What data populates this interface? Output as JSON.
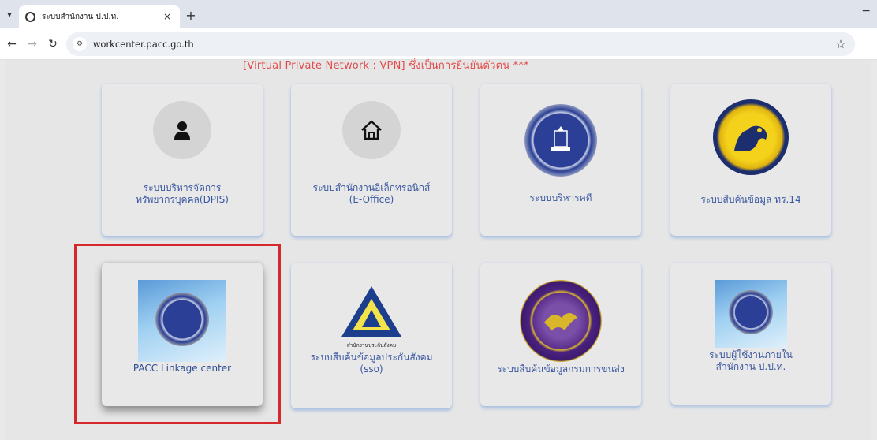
{
  "browser": {
    "tab_title": "ระบบสำนักงาน ป.ป.ท.",
    "tab_close": "×",
    "new_tab": "+",
    "minimize": "−",
    "url": "workcenter.pacc.go.th",
    "icons": [
      "dropdown-icon",
      "globe-icon",
      "close-icon",
      "plus-icon",
      "back-icon",
      "forward-icon",
      "reload-icon",
      "site-info-icon",
      "star-icon"
    ]
  },
  "notice": "[Virtual Private Network : VPN] ซึ่งเป็นการยืนยันตัวตน ***",
  "cards": [
    {
      "line1": "ระบบบริหารจัดการ",
      "line2": "ทรัพยากรบุคคล(DPIS)"
    },
    {
      "line1": "ระบบสำนักงานอิเล็กทรอนิกส์",
      "line2": "(E-Office)"
    },
    {
      "line1": "ระบบบริหารคดี",
      "line2": ""
    },
    {
      "line1": "ระบบสืบค้นข้อมูล ทร.14",
      "line2": ""
    },
    {
      "line1": "PACC Linkage center",
      "line2": ""
    },
    {
      "line1": "ระบบสืบค้นข้อมูลประกันสังคม",
      "line2": "(sso)",
      "logo_text": "สำนักงานประกันสังคม"
    },
    {
      "line1": "ระบบสืบค้นข้อมูลกรมการขนส่ง",
      "line2": ""
    },
    {
      "line1": "ระบบผู้ใช้งานภายใน",
      "line2": "สำนักงาน ป.ป.ท."
    }
  ],
  "colors": {
    "caption": "#3a57a0",
    "notice": "#e34a4a",
    "highlight": "#d6272c",
    "card_shadow": "#aac0e0"
  }
}
